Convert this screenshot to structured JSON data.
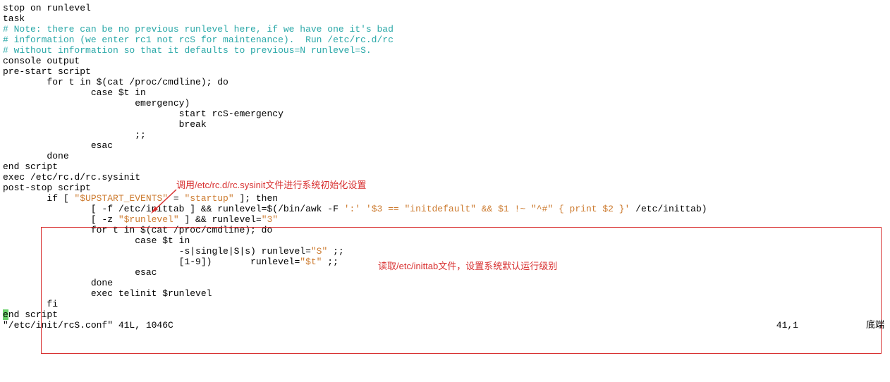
{
  "code": {
    "l1": "stop on runlevel",
    "l2": "",
    "l3": "task",
    "l4": "",
    "l5": "# Note: there can be no previous runlevel here, if we have one it's bad",
    "l6": "# information (we enter rc1 not rcS for maintenance).  Run /etc/rc.d/rc",
    "l7": "# without information so that it defaults to previous=N runlevel=S.",
    "l8": "console output",
    "l9": "pre-start script",
    "l10": "        for t in $(cat /proc/cmdline); do",
    "l11": "                case $t in",
    "l12": "                        emergency)",
    "l13": "                                start rcS-emergency",
    "l14": "                                break",
    "l15": "                        ;;",
    "l16": "                esac",
    "l17": "        done",
    "l18": "end script",
    "l19": "exec /etc/rc.d/rc.sysinit",
    "l20": "post-stop script",
    "l21a": "        if [ ",
    "l21b": "\"$UPSTART_EVENTS\"",
    "l21c": " = ",
    "l21d": "\"startup\"",
    "l21e": " ]; then",
    "l22a": "                [ -f /etc/inittab ] && runlevel=$(/bin/awk -F ",
    "l22b": "':' '$3 == \"initdefault\" && $1 !~ \"^#\" { print $2 }'",
    "l22c": " /etc/inittab)",
    "l23a": "                [ -z ",
    "l23b": "\"$runlevel\"",
    "l23c": " ] && runlevel=",
    "l23d": "\"3\"",
    "l24": "                for t in $(cat /proc/cmdline); do",
    "l25": "                        case $t in",
    "l26a": "                                -s|single|S|s) runlevel=",
    "l26b": "\"S\"",
    "l26c": " ;;",
    "l27a": "                                [1-9])       runlevel=",
    "l27b": "\"$t\"",
    "l27c": " ;;",
    "l28": "                        esac",
    "l29": "                done",
    "l30": "                exec telinit $runlevel",
    "l31": "        fi",
    "l32a": "e",
    "l32b": "nd script",
    "l33": "\"/etc/init/rcS.conf\" 41L, 1046C"
  },
  "annotations": {
    "a1": "调用/etc/rc.d/rc.sysinit文件进行系统初始化设置",
    "a2": "读取/etc/inittab文件，设置系统默认运行级别"
  },
  "status": {
    "pos": "41,1",
    "loc": "底端"
  }
}
